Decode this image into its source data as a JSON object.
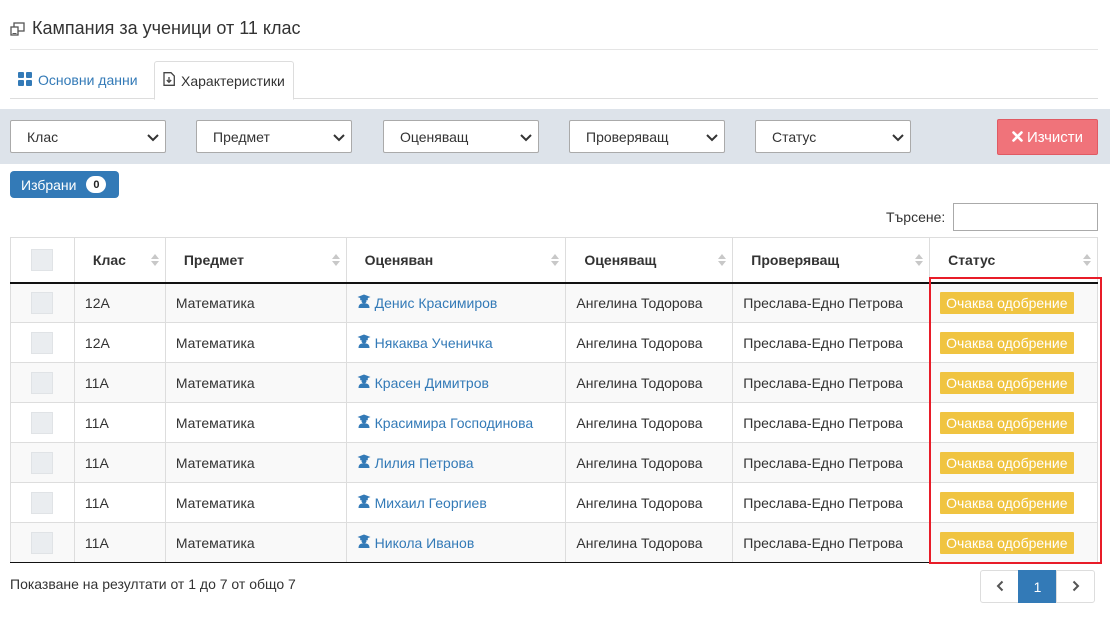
{
  "page": {
    "title": "Кампания за ученици от 11 клас"
  },
  "tabs": [
    {
      "label": "Основни данни",
      "icon": "grid-icon"
    },
    {
      "label": "Характеристики",
      "icon": "file-download-icon",
      "active": true
    }
  ],
  "filters": {
    "class": "Клас",
    "subject": "Предмет",
    "evaluator": "Оценяващ",
    "reviewer": "Проверяващ",
    "status": "Статус"
  },
  "clear_button": {
    "label": "Изчисти",
    "color": "#f0737a"
  },
  "selected": {
    "label": "Избрани",
    "count": "0"
  },
  "search": {
    "label": "Търсене:",
    "value": ""
  },
  "table": {
    "columns": [
      "Клас",
      "Предмет",
      "Оценяван",
      "Оценяващ",
      "Проверяващ",
      "Статус"
    ],
    "rows": [
      {
        "class": "12А",
        "subject": "Математика",
        "student": "Денис Красимиров",
        "evaluator": "Ангелина Тодорова",
        "reviewer": "Преслава-Едно Петрова",
        "status": "Очаква одобрение"
      },
      {
        "class": "12А",
        "subject": "Математика",
        "student": "Някаква Ученичка",
        "evaluator": "Ангелина Тодорова",
        "reviewer": "Преслава-Едно Петрова",
        "status": "Очаква одобрение"
      },
      {
        "class": "11А",
        "subject": "Математика",
        "student": "Красен Димитров",
        "evaluator": "Ангелина Тодорова",
        "reviewer": "Преслава-Едно Петрова",
        "status": "Очаква одобрение"
      },
      {
        "class": "11А",
        "subject": "Математика",
        "student": "Красимира Господинова",
        "evaluator": "Ангелина Тодорова",
        "reviewer": "Преслава-Едно Петрова",
        "status": "Очаква одобрение"
      },
      {
        "class": "11А",
        "subject": "Математика",
        "student": "Лилия Петрова",
        "evaluator": "Ангелина Тодорова",
        "reviewer": "Преслава-Едно Петрова",
        "status": "Очаква одобрение"
      },
      {
        "class": "11А",
        "subject": "Математика",
        "student": "Михаил Георгиев",
        "evaluator": "Ангелина Тодорова",
        "reviewer": "Преслава-Едно Петрова",
        "status": "Очаква одобрение"
      },
      {
        "class": "11А",
        "subject": "Математика",
        "student": "Никола Иванов",
        "evaluator": "Ангелина Тодорова",
        "reviewer": "Преслава-Едно Петрова",
        "status": "Очаква одобрение"
      }
    ]
  },
  "footer": {
    "info": "Показване на резултати от 1 до 7 от общо 7"
  },
  "pagination": {
    "prev": "‹",
    "current": "1",
    "next": "›"
  },
  "colors": {
    "accent": "#337ab7",
    "status_pending": "#f0c441",
    "highlight": "#e81c28",
    "filter_bar": "#dde3ea"
  }
}
